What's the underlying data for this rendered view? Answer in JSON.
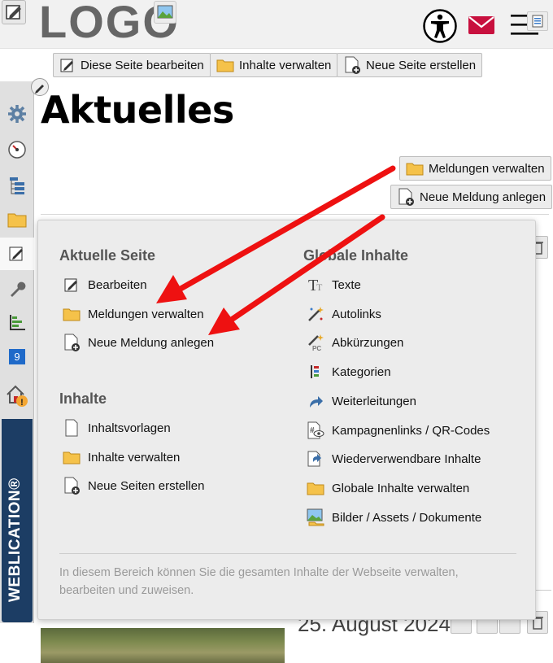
{
  "header": {
    "logo_text": "LOGO"
  },
  "toolbar": {
    "edit_page_label": "Diese Seite bearbeiten",
    "manage_content_label": "Inhalte verwalten",
    "new_page_label": "Neue Seite erstellen"
  },
  "left_toolbar": {
    "badge_count": "9",
    "brand": "WEBLICATION®"
  },
  "page": {
    "title": "Aktuelles",
    "manage_news_label": "Meldungen verwalten",
    "new_news_label": "Neue Meldung anlegen",
    "behind_date": "25. August 2024"
  },
  "panel": {
    "current_page_heading": "Aktuelle Seite",
    "current_page_items": [
      {
        "label": "Bearbeiten",
        "icon": "edit-icon"
      },
      {
        "label": "Meldungen verwalten",
        "icon": "folder-icon"
      },
      {
        "label": "Neue Meldung anlegen",
        "icon": "new-document-icon"
      }
    ],
    "content_heading": "Inhalte",
    "content_items": [
      {
        "label": "Inhaltsvorlagen",
        "icon": "document-icon"
      },
      {
        "label": "Inhalte verwalten",
        "icon": "folder-icon"
      },
      {
        "label": "Neue Seiten erstellen",
        "icon": "new-document-icon"
      }
    ],
    "global_heading": "Globale Inhalte",
    "global_items": [
      {
        "label": "Texte",
        "icon": "text-icon"
      },
      {
        "label": "Autolinks",
        "icon": "magic-link-icon"
      },
      {
        "label": "Abkürzungen",
        "icon": "abbreviation-icon"
      },
      {
        "label": "Kategorien",
        "icon": "categories-icon"
      },
      {
        "label": "Weiterleitungen",
        "icon": "redirect-icon"
      },
      {
        "label": "Kampagnenlinks / QR-Codes",
        "icon": "campaign-link-icon"
      },
      {
        "label": "Wiederverwendbare Inhalte",
        "icon": "reusable-content-icon"
      },
      {
        "label": "Globale Inhalte verwalten",
        "icon": "folder-icon"
      },
      {
        "label": "Bilder / Assets / Dokumente",
        "icon": "image-icon"
      }
    ],
    "note": "In diesem Bereich können Sie die gesamten Inhalte der Webseite verwalten, bearbeiten und zuweisen."
  },
  "colors": {
    "brand_blue": "#1c3d64",
    "arrow_red": "#ee1111",
    "folder_yellow": "#f5c24a",
    "mail_red": "#c8103e"
  }
}
